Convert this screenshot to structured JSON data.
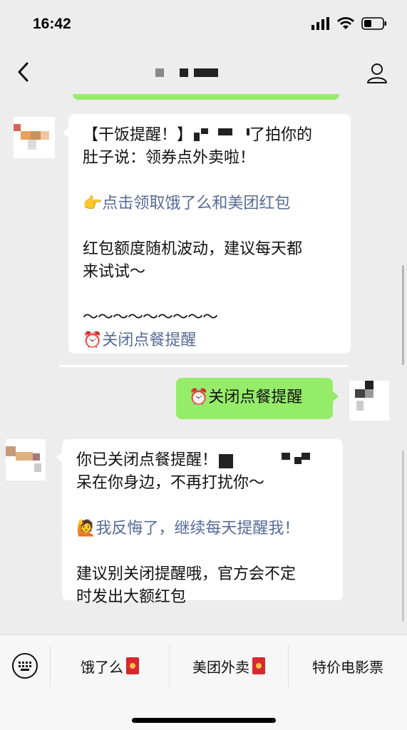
{
  "status": {
    "time": "16:42"
  },
  "chat": {
    "msg1": {
      "title_prefix": "【干饭提醒！】",
      "title_suffix": "了拍你的",
      "line2": "肚子说：领券点外卖啦！",
      "link_emoji": "👉",
      "link_text": "点击领取饿了么和美团红包",
      "body1": "红包额度随机波动，建议每天都",
      "body2": "来试试～",
      "tilde": "～～～～～～～～～",
      "close_emoji": "⏰",
      "close_text": "关闭点餐提醒"
    },
    "msg2": {
      "emoji": "⏰",
      "text": "关闭点餐提醒"
    },
    "msg3": {
      "line1": "你已关闭点餐提醒！",
      "line2": "呆在你身边，不再打扰你～",
      "link_emoji": "🙋",
      "link_text": "我反悔了，继续每天提醒我！",
      "body1": "建议别关闭提醒哦，官方会不定",
      "body2": "时发出大额红包"
    }
  },
  "bottom_menu": {
    "item1": "饿了么",
    "item2": "美团外卖",
    "item3": "特价电影票"
  }
}
